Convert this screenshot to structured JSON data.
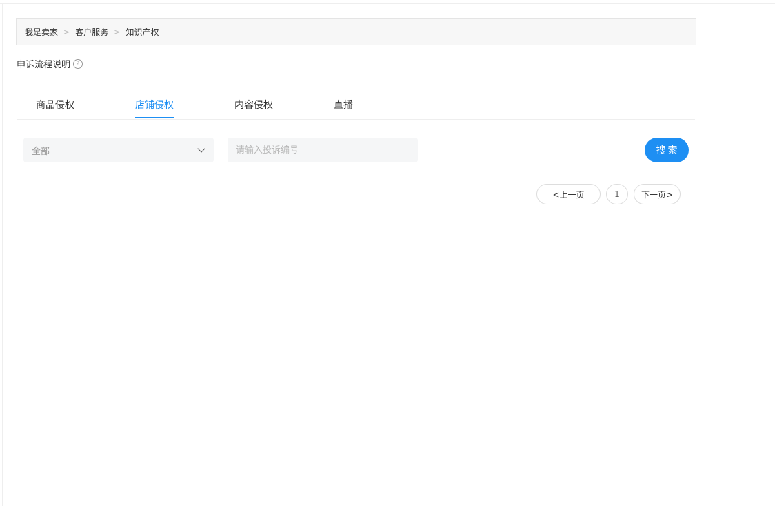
{
  "breadcrumb": {
    "items": [
      "我是卖家",
      "客户服务",
      "知识产权"
    ],
    "separator": ">"
  },
  "appeal": {
    "label": "申诉流程说明",
    "help_icon": "?"
  },
  "tabs": [
    {
      "label": "商品侵权",
      "active": false
    },
    {
      "label": "店铺侵权",
      "active": true
    },
    {
      "label": "内容侵权",
      "active": false
    },
    {
      "label": "直播",
      "active": false
    }
  ],
  "filter": {
    "select_value": "全部",
    "search_placeholder": "请输入投诉编号",
    "search_button": "搜索"
  },
  "pagination": {
    "prev": "<上一页",
    "page": "1",
    "next": "下一页>"
  },
  "colors": {
    "accent": "#1e8ff3"
  }
}
